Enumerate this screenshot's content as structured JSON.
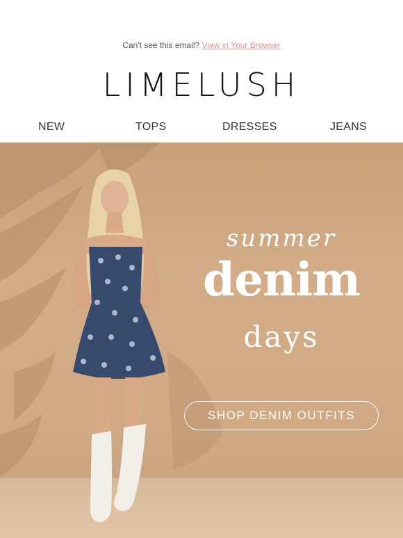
{
  "preheader": {
    "text": "Can't see this email?",
    "link": "View in Your Browser"
  },
  "brand": {
    "logo": "LIMELUSH"
  },
  "nav": {
    "items": [
      "NEW",
      "TOPS",
      "DRESSES",
      "JEANS"
    ]
  },
  "hero": {
    "line1": "summer",
    "line2": "denim",
    "line3": "days",
    "cta": "SHOP DENIM OUTFITS"
  },
  "colors": {
    "link": "#e58f8f",
    "hero_bg": "#cfa883",
    "text_white": "#ffffff",
    "nav_text": "#333333"
  }
}
